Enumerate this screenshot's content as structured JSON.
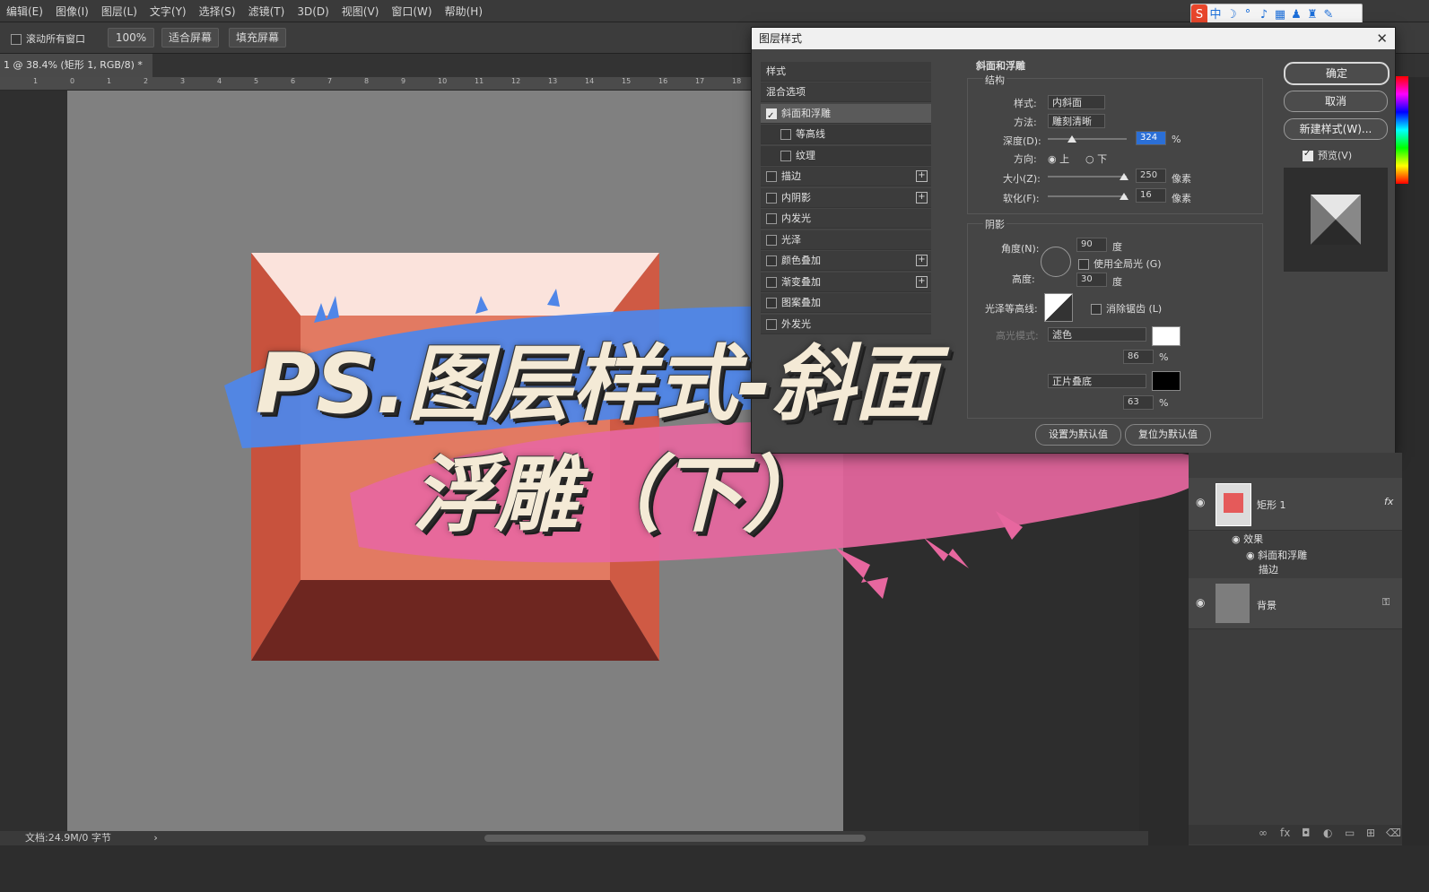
{
  "menu": [
    "编辑(E)",
    "图像(I)",
    "图层(L)",
    "文字(Y)",
    "选择(S)",
    "滤镜(T)",
    "3D(D)",
    "视图(V)",
    "窗口(W)",
    "帮助(H)"
  ],
  "options_bar": {
    "scroll_all_label": "滚动所有窗口",
    "zoom_label": "100%",
    "fit_screen_label": "适合屏幕",
    "fill_screen_label": "填充屏幕"
  },
  "document_tab": {
    "label": "1 @ 38.4% (矩形 1, RGB/8) *",
    "close": "×"
  },
  "ruler_ticks": [
    "1",
    "0",
    "1",
    "2",
    "3",
    "4",
    "5",
    "6",
    "7",
    "8",
    "9",
    "10",
    "11",
    "12",
    "13",
    "14",
    "15",
    "16",
    "17",
    "18"
  ],
  "status_bar": {
    "doc_size": "文档:24.9M/0 字节",
    "arrow": "›"
  },
  "dialog": {
    "title": "图层样式",
    "close_icon": "✕",
    "style_list": [
      {
        "label": "样式"
      },
      {
        "label": "混合选项"
      },
      {
        "label": "斜面和浮雕",
        "checked": true,
        "selected": true
      },
      {
        "label": "等高线",
        "sub": true
      },
      {
        "label": "纹理",
        "sub": true
      },
      {
        "label": "描边",
        "plus": true
      },
      {
        "label": "内阴影",
        "plus": true
      },
      {
        "label": "内发光"
      },
      {
        "label": "光泽"
      },
      {
        "label": "颜色叠加",
        "plus": true
      },
      {
        "label": "渐变叠加",
        "plus": true
      },
      {
        "label": "图案叠加"
      },
      {
        "label": "外发光"
      }
    ],
    "section_title": "斜面和浮雕",
    "structure_title": "结构",
    "structure": {
      "style_label": "样式:",
      "style_value": "内斜面",
      "technique_label": "方法:",
      "technique_value": "雕刻清晰",
      "depth_label": "深度(D):",
      "depth_value": "324",
      "depth_unit": "%",
      "direction_label": "方向:",
      "direction_up": "上",
      "direction_down": "下",
      "size_label": "大小(Z):",
      "size_value": "250",
      "size_unit": "像素",
      "soften_label": "软化(F):",
      "soften_value": "16",
      "soften_unit": "像素"
    },
    "shading_title": "阴影",
    "shading": {
      "angle_label": "角度(N):",
      "angle_value": "90",
      "angle_unit": "度",
      "global_light_label": "使用全局光 (G)",
      "altitude_label": "高度:",
      "altitude_value": "30",
      "altitude_unit": "度",
      "gloss_label": "光泽等高线:",
      "antialias_label": "消除锯齿 (L)",
      "highlight_mode_label": "高光模式:",
      "highlight_mode_value": "滤色",
      "highlight_opacity": "86",
      "shadow_mode_value": "正片叠底",
      "shadow_opacity": "63",
      "pct": "%",
      "highlight_color": "#ffffff",
      "shadow_color": "#000000"
    },
    "buttons": {
      "ok": "确定",
      "cancel": "取消",
      "new_style": "新建样式(W)...",
      "preview": "预览(V)",
      "make_default": "设置为默认值",
      "reset_default": "复位为默认值"
    }
  },
  "layers": {
    "layer1_name": "矩形 1",
    "effects_label": "效果",
    "effect_bevel": "斜面和浮雕",
    "effect_stroke": "描边",
    "background_name": "背景",
    "fx": "fx"
  },
  "overlay_title": {
    "line1": "PS.图层样式-斜面",
    "line2": "浮雕（下）"
  },
  "colors": {
    "accent_blue": "#4f86e8",
    "accent_pink": "#e7679f",
    "art_face": "#e27a62"
  }
}
